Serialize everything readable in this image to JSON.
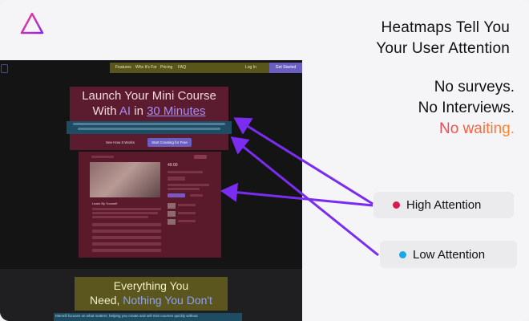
{
  "header": {
    "logo_icon": "triangle-logo-icon",
    "headline_line1": "Heatmaps Tell You",
    "headline_line2": "Your User Attention"
  },
  "taglines": {
    "line1": "No surveys.",
    "line2": "No Interviews.",
    "line3": "No waiting."
  },
  "legend": {
    "high": {
      "label": "High Attention",
      "color": "#d81b4a"
    },
    "low": {
      "label": "Low Attention",
      "color": "#1aa7e6"
    }
  },
  "screenshot": {
    "nav": {
      "items": [
        "Features",
        "Who It's For",
        "Pricing",
        "FAQ"
      ],
      "login": "Log In",
      "get_started": "Get Started"
    },
    "hero": {
      "title_line1": "Launch Your Mini Course",
      "title_with": "With ",
      "title_ai": "AI",
      "title_in": " in ",
      "title_minutes": "30 Minutes",
      "btn_how": "See How It Works",
      "btn_start": "Start Creating for Free"
    },
    "product": {
      "title": "Learn By Yourself",
      "price": "49.00"
    },
    "section2": {
      "line1": "Everything You",
      "line2a": "Need, ",
      "line2b": "Nothing You Don't",
      "footer_text": "Memrill focuses on what matters: helping you create and sell mini courses quickly without"
    }
  },
  "colors": {
    "hot": "#5c1c2f",
    "warm": "#5a561d",
    "cool": "#1e4c62",
    "arrow": "#7a2df0"
  }
}
